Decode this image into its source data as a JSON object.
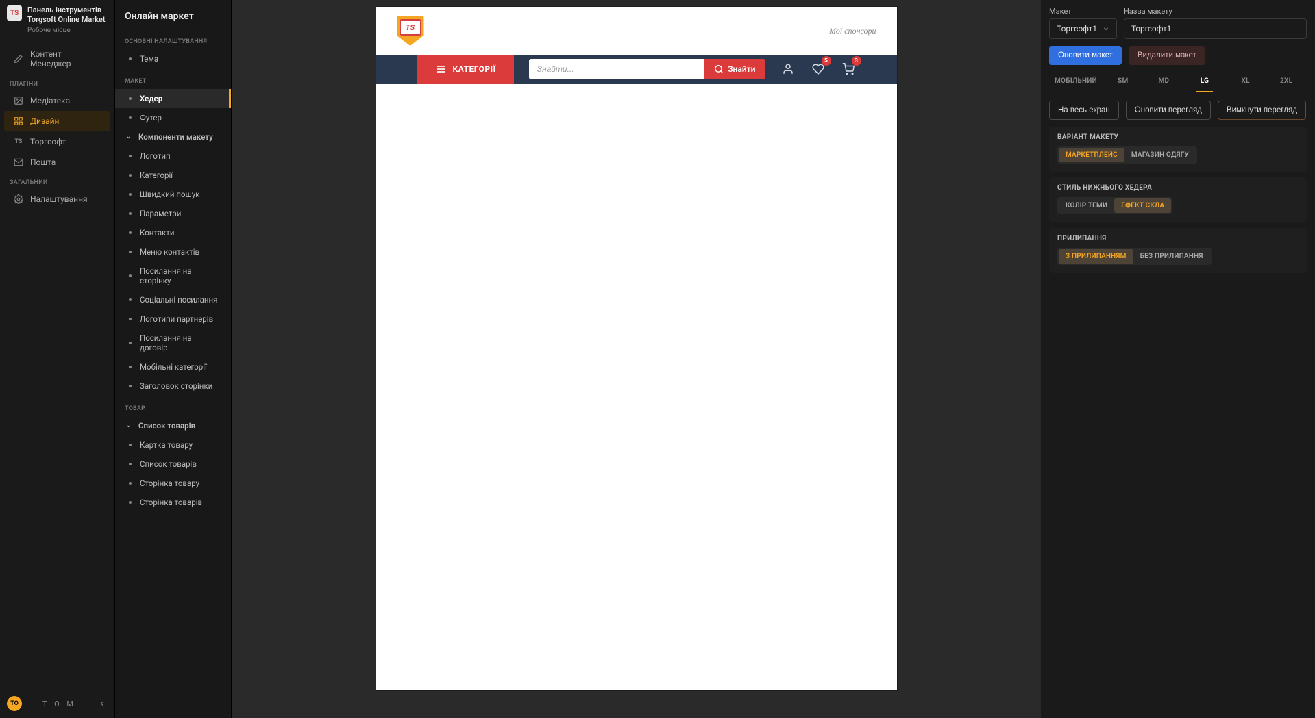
{
  "nav": {
    "logo_text": "TS",
    "title": "Панель інструментів Torgsoft Online Market",
    "subtitle": "Робоче місце",
    "items_top": [
      {
        "label": "Контент Менеджер",
        "icon": "pencil"
      }
    ],
    "section_plugins": "ПЛАГІНИ",
    "items_plugins": [
      {
        "label": "Медіатека",
        "icon": "image"
      },
      {
        "label": "Дизайн",
        "icon": "grid",
        "active": true
      },
      {
        "label": "Торгсофт",
        "icon": "ts"
      },
      {
        "label": "Пошта",
        "icon": "mail"
      }
    ],
    "section_general": "ЗАГАЛЬНИЙ",
    "items_general": [
      {
        "label": "Налаштування",
        "icon": "gear"
      }
    ],
    "footer": {
      "avatar": "TO",
      "label": "T O M"
    }
  },
  "subnav": {
    "title": "Онлайн маркет",
    "sections": [
      {
        "label": "ОСНОВНІ НАЛАШТУВАННЯ",
        "items": [
          {
            "label": "Тема"
          }
        ]
      },
      {
        "label": "МАКЕТ",
        "items": [
          {
            "label": "Хедер",
            "active": true,
            "bold": true
          },
          {
            "label": "Футер"
          },
          {
            "label": "Компоненти макету",
            "bold": true,
            "chev": true
          },
          {
            "label": "Логотип"
          },
          {
            "label": "Категорії"
          },
          {
            "label": "Швидкий пошук"
          },
          {
            "label": "Параметри"
          },
          {
            "label": "Контакти"
          },
          {
            "label": "Меню контактів"
          },
          {
            "label": "Посилання на сторінку"
          },
          {
            "label": "Соціальні посилання"
          },
          {
            "label": "Логотипи партнерів"
          },
          {
            "label": "Посилання на договір"
          },
          {
            "label": "Мобільні категорії"
          },
          {
            "label": "Заголовок сторінки"
          }
        ]
      },
      {
        "label": "ТОВАР",
        "items": [
          {
            "label": "Список товарів",
            "bold": true,
            "chev": true
          },
          {
            "label": "Картка товару"
          },
          {
            "label": "Список товарів"
          },
          {
            "label": "Сторінка товару"
          },
          {
            "label": "Сторінка товарів"
          }
        ]
      }
    ]
  },
  "preview": {
    "logo_text": "TS",
    "sponsors": "Мої спонсори",
    "categories_btn": "КАТЕГОРІЇ",
    "search_placeholder": "Знайти...",
    "search_btn": "Знайти",
    "wishlist_badge": "5",
    "cart_badge": "3"
  },
  "right": {
    "layout_label": "Макет",
    "layout_select_value": "Торгсофт1",
    "name_label": "Назва макету",
    "name_value": "Торгсофт1",
    "update_btn": "Оновити макет",
    "delete_btn": "Видалити макет",
    "tabs": [
      "МОБІЛЬНИЙ",
      "SM",
      "MD",
      "LG",
      "XL",
      "2XL"
    ],
    "active_tab": "LG",
    "view_buttons": {
      "full": "На весь екран",
      "refresh": "Оновити перегляд",
      "disable": "Вимкнути перегляд"
    },
    "groups": [
      {
        "title": "ВАРІАНТ МАКЕТУ",
        "options": [
          "МАРКЕТПЛЕЙС",
          "МАГАЗИН ОДЯГУ"
        ],
        "active": 0
      },
      {
        "title": "СТИЛЬ НИЖНЬОГО ХЕДЕРА",
        "options": [
          "КОЛІР ТЕМИ",
          "ЕФЕКТ СКЛА"
        ],
        "active": 1
      },
      {
        "title": "ПРИЛИПАННЯ",
        "options": [
          "З ПРИЛИПАННЯМ",
          "БЕЗ ПРИЛИПАННЯ"
        ],
        "active": 0
      }
    ]
  }
}
